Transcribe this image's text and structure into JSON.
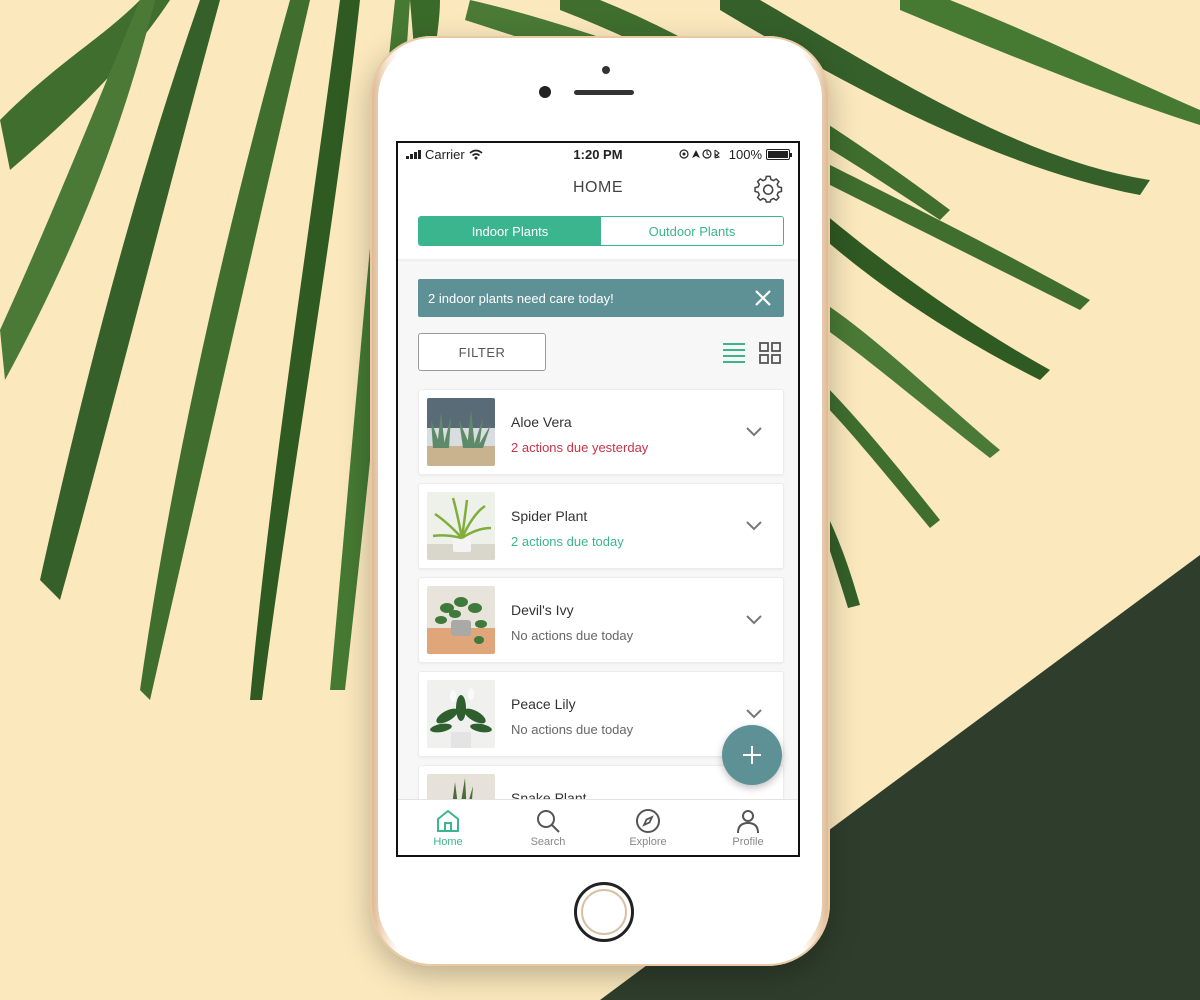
{
  "status_bar": {
    "carrier": "Carrier",
    "time": "1:20 PM",
    "battery": "100%"
  },
  "header": {
    "title": "HOME",
    "settings_icon": "gear-icon"
  },
  "segments": {
    "indoor": "Indoor Plants",
    "outdoor": "Outdoor Plants",
    "active": "indoor"
  },
  "alert": {
    "text": "2 indoor plants need care today!",
    "close_icon": "close-icon"
  },
  "filter": {
    "label": "FILTER"
  },
  "view_toggle": {
    "list_icon": "list-view-icon",
    "grid_icon": "grid-view-icon",
    "active": "list"
  },
  "plants": [
    {
      "name": "Aloe Vera",
      "status": "2 actions due yesterday",
      "status_type": "overdue"
    },
    {
      "name": "Spider Plant",
      "status": "2 actions due today",
      "status_type": "due"
    },
    {
      "name": "Devil's Ivy",
      "status": "No actions due today",
      "status_type": "none"
    },
    {
      "name": "Peace Lily",
      "status": "No actions due today",
      "status_type": "none"
    },
    {
      "name": "Snake Plant",
      "status": "",
      "status_type": "none"
    }
  ],
  "fab": {
    "icon": "plus-icon"
  },
  "tabbar": {
    "items": [
      {
        "label": "Home",
        "icon": "home-icon",
        "active": true
      },
      {
        "label": "Search",
        "icon": "search-icon",
        "active": false
      },
      {
        "label": "Explore",
        "icon": "compass-icon",
        "active": false
      },
      {
        "label": "Profile",
        "icon": "user-icon",
        "active": false
      }
    ]
  },
  "colors": {
    "accent": "#3bb58e",
    "teal": "#5e9196",
    "overdue": "#c8334b",
    "background": "#fbe8bd",
    "dark_green": "#2f3e2c",
    "leaf": "#3f6e2e"
  }
}
